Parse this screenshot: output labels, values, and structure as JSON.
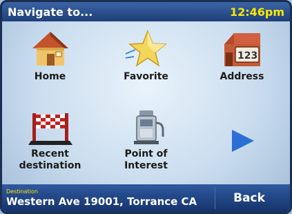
{
  "header": {
    "title": "Navigate to...",
    "time": "12:46pm"
  },
  "menu": {
    "items": [
      {
        "label": "Home",
        "icon": "home-icon"
      },
      {
        "label": "Favorite",
        "icon": "star-icon"
      },
      {
        "label": "Address",
        "icon": "address-icon"
      },
      {
        "label": "Recent\ndestination",
        "icon": "checkered-flag-icon"
      },
      {
        "label": "Point of\nInterest",
        "icon": "point-of-interest-icon"
      }
    ],
    "next_icon": "right-arrow-icon"
  },
  "footer": {
    "caption": "Destination",
    "destination": "Western Ave 19001, Torrance CA",
    "back_label": "Back"
  },
  "colors": {
    "bar": "#1f3f78",
    "accent": "#ffe600",
    "arrow": "#2a6fd6"
  }
}
